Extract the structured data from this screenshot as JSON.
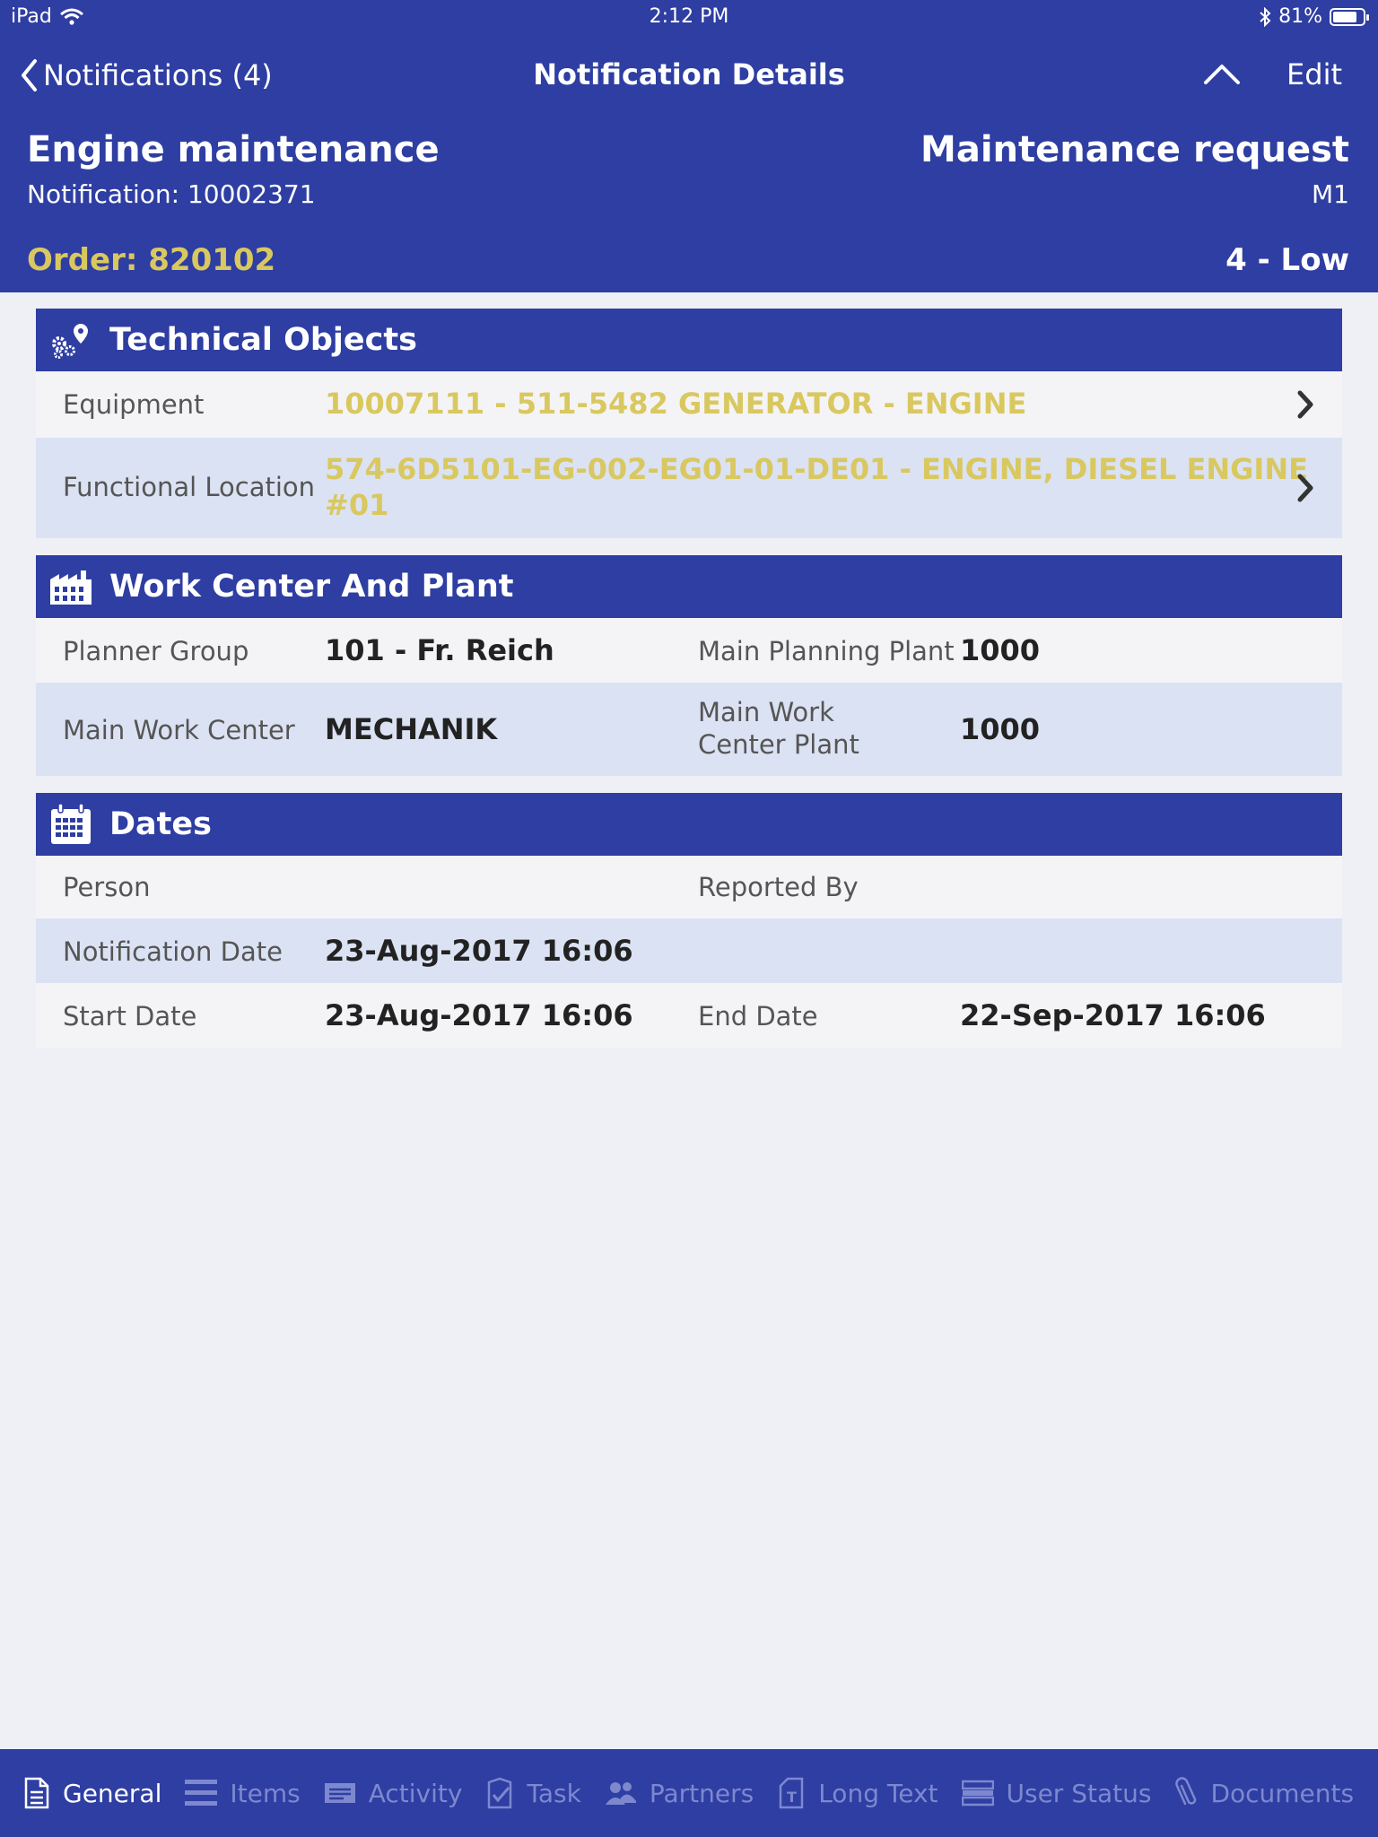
{
  "status_bar": {
    "device": "iPad",
    "time": "2:12 PM",
    "battery": "81%",
    "battery_level": 0.81
  },
  "nav": {
    "back_label": "Notifications (4)",
    "title": "Notification Details",
    "edit_label": "Edit"
  },
  "header": {
    "title": "Engine maintenance",
    "notification": "Notification: 10002371",
    "type": "Maintenance request",
    "type_code": "M1",
    "order": "Order: 820102",
    "priority": "4 - Low"
  },
  "technical_objects": {
    "title": "Technical Objects",
    "equipment_label": "Equipment",
    "equipment_value": "10007111 - 511-5482 GENERATOR - ENGINE",
    "location_label": "Functional Location",
    "location_value_line1": "574-6D5101-EG-002-EG01-01-DE01 - ENGINE, DIESEL ENGINE",
    "location_value_line2": "#01"
  },
  "work_center": {
    "title": "Work Center And Plant",
    "planner_group_label": "Planner Group",
    "planner_group_value": "101 - Fr. Reich",
    "main_planning_plant_label": "Main Planning Plant",
    "main_planning_plant_value": "1000",
    "main_work_center_label": "Main Work Center",
    "main_work_center_value": "MECHANIK",
    "main_wc_plant_label_line1": "Main Work",
    "main_wc_plant_label_line2": "Center Plant",
    "main_wc_plant_value": "1000"
  },
  "dates": {
    "title": "Dates",
    "person_label": "Person",
    "reported_by_label": "Reported By",
    "notification_date_label": "Notification Date",
    "notification_date_value": "23-Aug-2017 16:06",
    "start_date_label": "Start Date",
    "start_date_value": "23-Aug-2017 16:06",
    "end_date_label": "End Date",
    "end_date_value": "22-Sep-2017 16:06"
  },
  "tabs": [
    {
      "label": "General",
      "icon": "document-icon"
    },
    {
      "label": "Items",
      "icon": "list-icon"
    },
    {
      "label": "Activity",
      "icon": "activity-icon"
    },
    {
      "label": "Task",
      "icon": "task-icon"
    },
    {
      "label": "Partners",
      "icon": "people-icon"
    },
    {
      "label": "Long Text",
      "icon": "long-text-icon"
    },
    {
      "label": "User Status",
      "icon": "user-status-icon"
    },
    {
      "label": "Documents",
      "icon": "paperclip-icon"
    }
  ],
  "colors": {
    "primary": "#2e3ea2",
    "accent": "#d9c85f",
    "row_alt": "#dbe2f3",
    "background": "#eff0f5"
  }
}
